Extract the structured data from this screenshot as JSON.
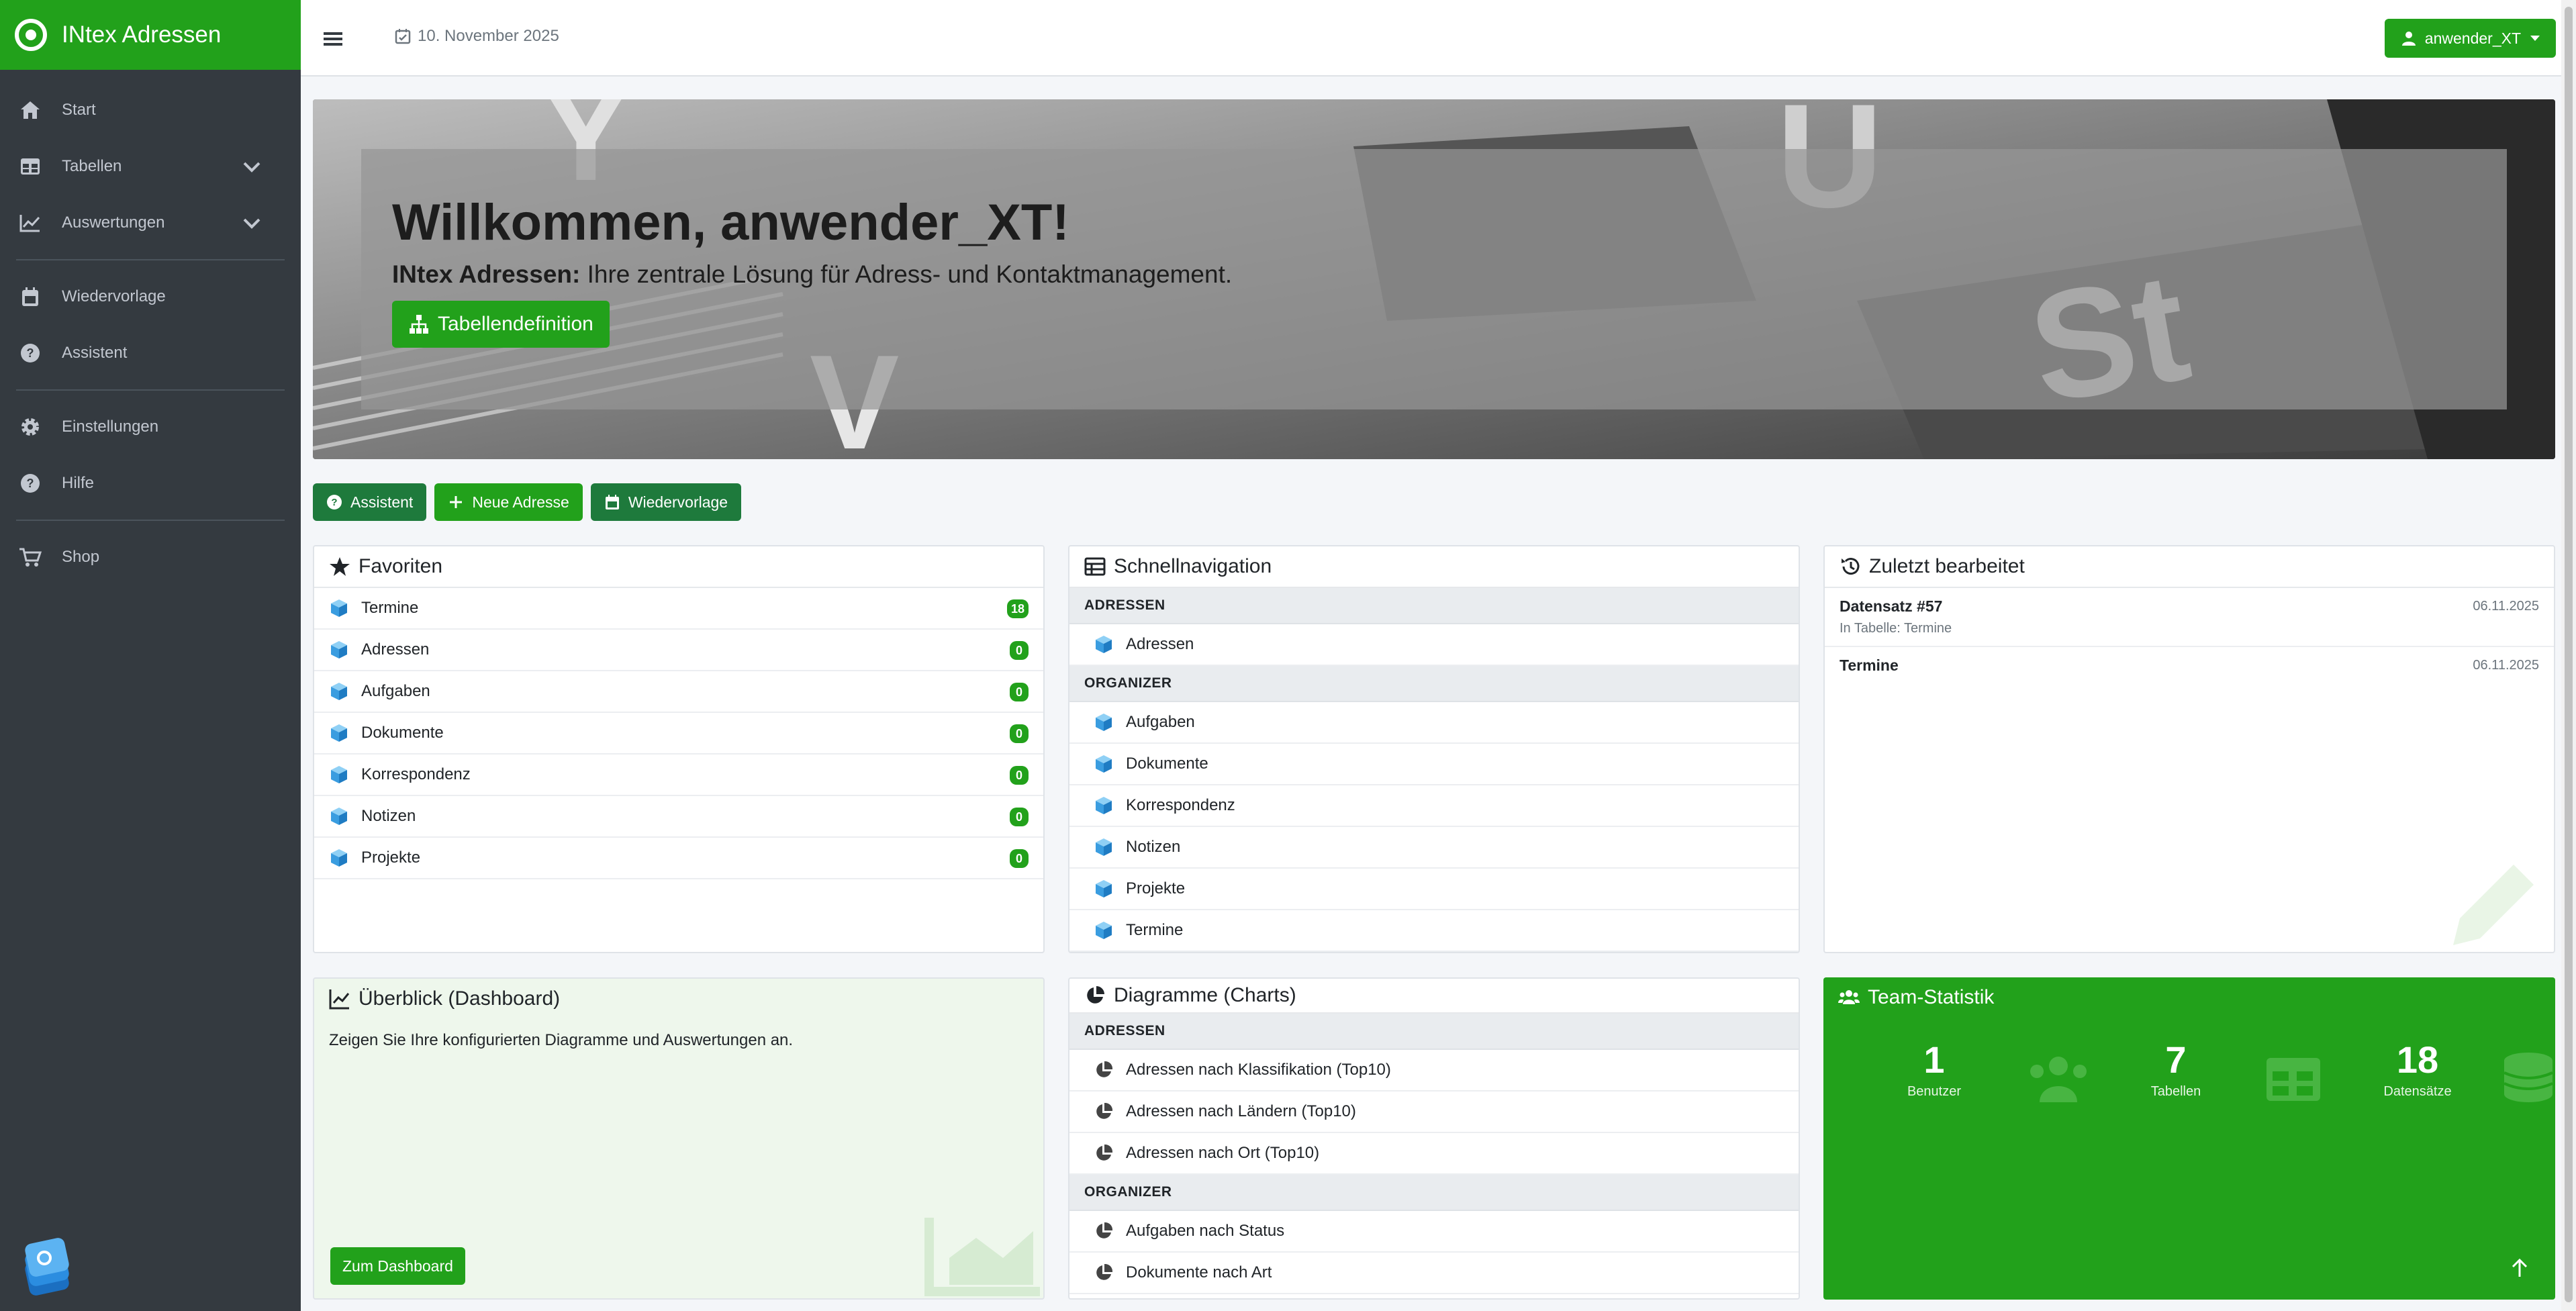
{
  "app": {
    "title": "INtex Adressen"
  },
  "sidebar": {
    "items": [
      {
        "label": "Start",
        "icon": "home-icon"
      },
      {
        "label": "Tabellen",
        "icon": "table-icon",
        "expandable": true
      },
      {
        "label": "Auswertungen",
        "icon": "chart-line-icon",
        "expandable": true
      },
      {
        "label": "Wiedervorlage",
        "icon": "calendar-icon"
      },
      {
        "label": "Assistent",
        "icon": "question-circle-icon"
      },
      {
        "label": "Einstellungen",
        "icon": "gear-icon"
      },
      {
        "label": "Hilfe",
        "icon": "question-circle-icon"
      },
      {
        "label": "Shop",
        "icon": "cart-icon"
      }
    ]
  },
  "topbar": {
    "date": "10. November 2025",
    "user": "anwender_XT"
  },
  "hero": {
    "title": "Willkommen, anwender_XT!",
    "sub_bold": "INtex Adressen:",
    "sub_text": " Ihre zentrale Lösung für Adress- und Kontaktmanagement.",
    "button": "Tabellendefinition"
  },
  "quick": {
    "assistant": "Assistent",
    "new_address": "Neue Adresse",
    "followup": "Wiedervorlage"
  },
  "favorites": {
    "title": "Favoriten",
    "items": [
      {
        "label": "Termine",
        "count": "18"
      },
      {
        "label": "Adressen",
        "count": "0"
      },
      {
        "label": "Aufgaben",
        "count": "0"
      },
      {
        "label": "Dokumente",
        "count": "0"
      },
      {
        "label": "Korrespondenz",
        "count": "0"
      },
      {
        "label": "Notizen",
        "count": "0"
      },
      {
        "label": "Projekte",
        "count": "0"
      }
    ]
  },
  "quicknav": {
    "title": "Schnellnavigation",
    "groups": [
      {
        "name": "ADRESSEN",
        "items": [
          "Adressen"
        ]
      },
      {
        "name": "ORGANIZER",
        "items": [
          "Aufgaben",
          "Dokumente",
          "Korrespondenz",
          "Notizen",
          "Projekte",
          "Termine"
        ]
      }
    ]
  },
  "recent": {
    "title": "Zuletzt bearbeitet",
    "items": [
      {
        "title": "Datensatz #57",
        "sub": "In Tabelle: Termine",
        "date": "06.11.2025"
      },
      {
        "title": "Termine",
        "sub": "",
        "date": "06.11.2025"
      }
    ]
  },
  "dashboard": {
    "title": "Überblick (Dashboard)",
    "text": "Zeigen Sie Ihre konfigurierten Diagramme und Auswertungen an.",
    "button": "Zum Dashboard"
  },
  "charts": {
    "title": "Diagramme (Charts)",
    "groups": [
      {
        "name": "ADRESSEN",
        "items": [
          "Adressen nach Klassifikation (Top10)",
          "Adressen nach Ländern (Top10)",
          "Adressen nach Ort (Top10)"
        ]
      },
      {
        "name": "ORGANIZER",
        "items": [
          "Aufgaben nach Status",
          "Dokumente nach Art"
        ]
      }
    ]
  },
  "team": {
    "title": "Team-Statistik",
    "stats": [
      {
        "value": "1",
        "label": "Benutzer"
      },
      {
        "value": "7",
        "label": "Tabellen"
      },
      {
        "value": "18",
        "label": "Datensätze"
      }
    ]
  },
  "colors": {
    "brand": "#22a11b",
    "sidebar": "#343a40",
    "dark_button": "#1e7a3c"
  }
}
